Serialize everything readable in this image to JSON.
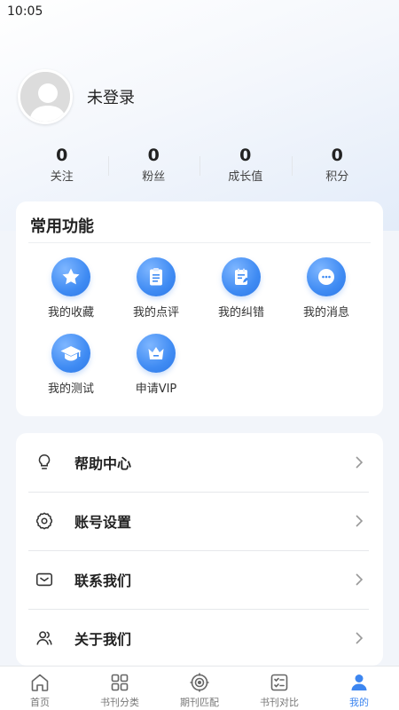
{
  "status_bar": {
    "time": "10:05"
  },
  "profile": {
    "username": "未登录"
  },
  "stats": [
    {
      "value": "0",
      "label": "关注"
    },
    {
      "value": "0",
      "label": "粉丝"
    },
    {
      "value": "0",
      "label": "成长值"
    },
    {
      "value": "0",
      "label": "积分"
    }
  ],
  "functions": {
    "title": "常用功能",
    "items": [
      {
        "label": "我的收藏",
        "icon": "star-icon"
      },
      {
        "label": "我的点评",
        "icon": "clipboard-icon"
      },
      {
        "label": "我的纠错",
        "icon": "edit-list-icon"
      },
      {
        "label": "我的消息",
        "icon": "message-icon"
      },
      {
        "label": "我的测试",
        "icon": "graduation-cap-icon"
      },
      {
        "label": "申请VIP",
        "icon": "crown-icon"
      }
    ]
  },
  "menu": [
    {
      "label": "帮助中心",
      "icon": "lightbulb-icon"
    },
    {
      "label": "账号设置",
      "icon": "gear-icon"
    },
    {
      "label": "联系我们",
      "icon": "mail-icon"
    },
    {
      "label": "关于我们",
      "icon": "users-icon"
    }
  ],
  "tabbar": [
    {
      "label": "首页",
      "icon": "home-icon",
      "active": false
    },
    {
      "label": "书刊分类",
      "icon": "grid-icon",
      "active": false
    },
    {
      "label": "期刊匹配",
      "icon": "target-icon",
      "active": false
    },
    {
      "label": "书刊对比",
      "icon": "compare-icon",
      "active": false
    },
    {
      "label": "我的",
      "icon": "person-icon",
      "active": true
    }
  ],
  "colors": {
    "accent": "#3d86f0",
    "icon_blue": "#3f8bf3",
    "background": "#f2f5fa"
  }
}
